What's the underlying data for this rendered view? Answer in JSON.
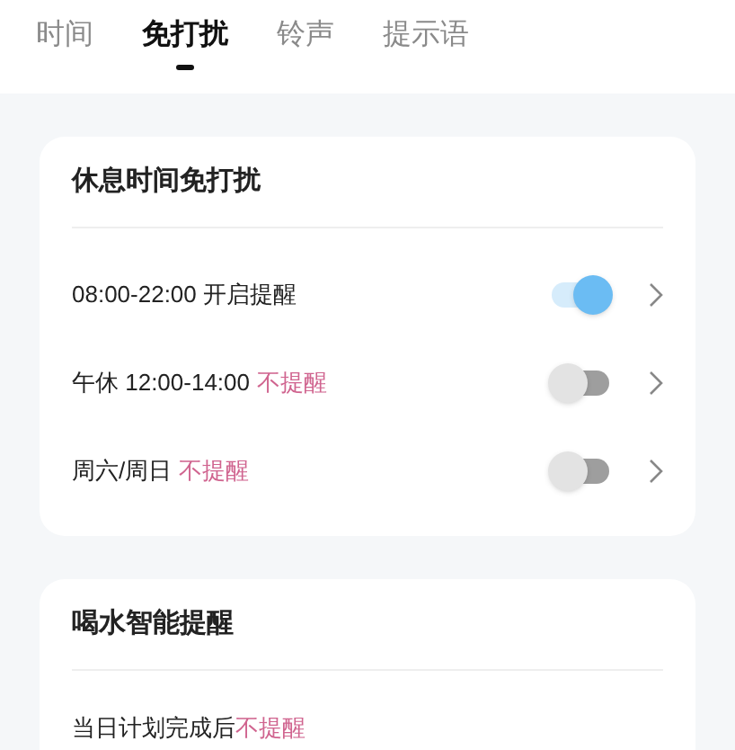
{
  "tabs": [
    {
      "label": "时间",
      "selected": false
    },
    {
      "label": "免打扰",
      "selected": true
    },
    {
      "label": "铃声",
      "selected": false
    },
    {
      "label": "提示语",
      "selected": false
    }
  ],
  "sections": [
    {
      "title": "休息时间免打扰",
      "rows": [
        {
          "kind": "toggle",
          "text": "08:00-22:00 开启提醒",
          "on": true
        },
        {
          "kind": "toggle",
          "text": "午休 12:00-14:00",
          "note": "不提醒",
          "on": false
        },
        {
          "kind": "toggle",
          "text": "周六/周日",
          "note": "不提醒",
          "on": false
        }
      ]
    },
    {
      "title": "喝水智能提醒",
      "rows": [
        {
          "kind": "plain",
          "text": "当日计划完成后",
          "note": "不提醒"
        }
      ]
    }
  ]
}
